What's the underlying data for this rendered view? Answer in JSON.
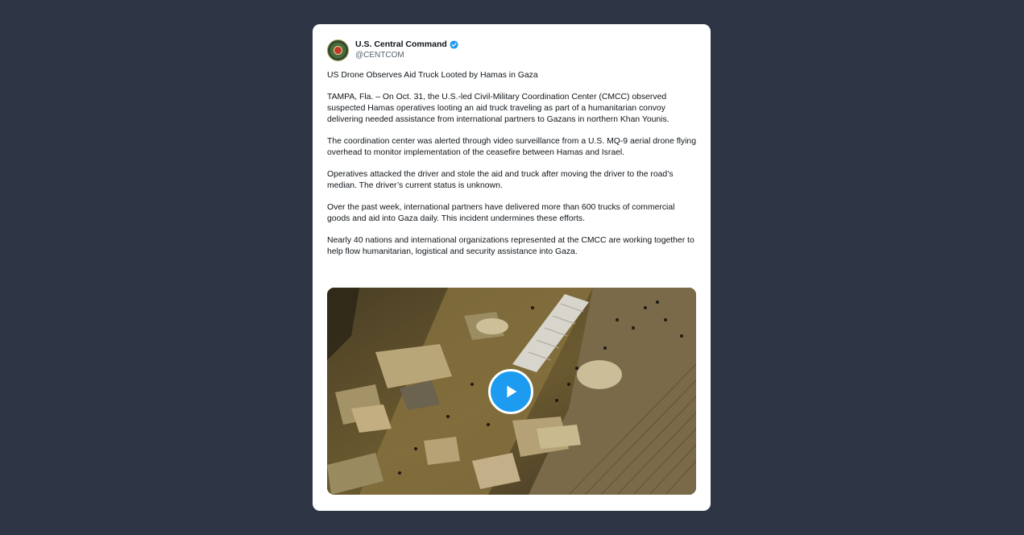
{
  "tweet": {
    "author_name": "U.S. Central Command",
    "author_handle": "@CENTCOM",
    "verified": true,
    "paragraphs": [
      "US Drone Observes Aid Truck Looted by Hamas in Gaza",
      "TAMPA, Fla. – On Oct. 31, the U.S.-led Civil-Military Coordination Center (CMCC) observed suspected Hamas operatives looting an aid truck traveling as part of a humanitarian convoy delivering needed assistance from international partners to Gazans in northern Khan Younis.",
      "The coordination center was alerted through video surveillance from a U.S. MQ-9 aerial drone flying overhead to monitor implementation of the ceasefire between Hamas and Israel.",
      "Operatives attacked the driver and stole the aid and truck after moving the driver to the road’s median. The driver’s current status is unknown.",
      "Over the past week, international partners have delivered more than 600 trucks of commercial goods and aid into Gaza daily. This incident undermines these efforts.",
      "Nearly 40 nations and international organizations represented at the CMCC are working together to help flow humanitarian, logistical and security assistance into Gaza."
    ],
    "media": {
      "type": "video",
      "play_icon": "play-icon"
    }
  },
  "colors": {
    "background": "#2e3645",
    "card": "#ffffff",
    "verified_blue": "#1d9bf0",
    "play_blue": "#1d9bf0",
    "text": "#0f1419",
    "secondary_text": "#536471"
  }
}
